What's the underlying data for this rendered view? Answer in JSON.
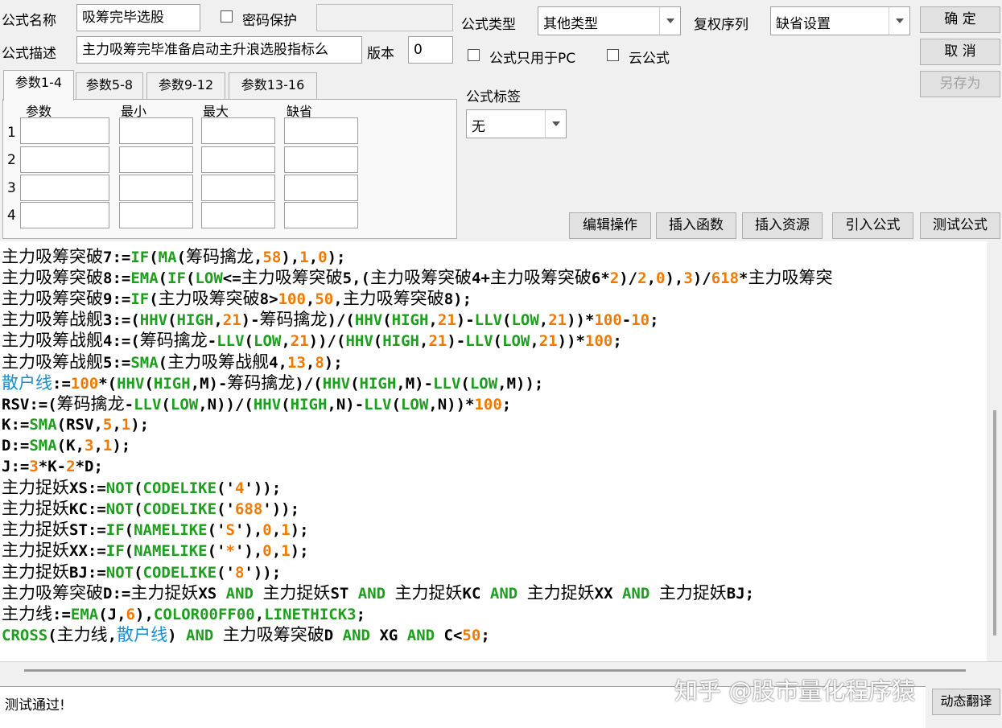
{
  "form": {
    "name_label": "公式名称",
    "name_value": "吸筹完毕选股",
    "password_label": "密码保护",
    "password_value": "",
    "desc_label": "公式描述",
    "desc_value": "主力吸筹完毕准备启动主升浪选股指标么",
    "version_label": "版本",
    "version_value": "0",
    "type_label": "公式类型",
    "type_value": "其他类型",
    "rights_label": "复权序列",
    "rights_value": "缺省设置",
    "pc_only_label": "公式只用于PC",
    "cloud_label": "云公式",
    "tag_label": "公式标签",
    "tag_value": "无"
  },
  "buttons": {
    "ok": "确 定",
    "cancel": "取 消",
    "save_as": "另存为",
    "edit_ops": "编辑操作",
    "insert_func": "插入函数",
    "insert_res": "插入资源",
    "import_formula": "引入公式",
    "test_formula": "测试公式",
    "dynamic_translate": "动态翻译"
  },
  "params": {
    "tabs": [
      "参数1-4",
      "参数5-8",
      "参数9-12",
      "参数13-16"
    ],
    "headers": [
      "参数",
      "最小",
      "最大",
      "缺省"
    ],
    "rows": [
      "1",
      "2",
      "3",
      "4"
    ]
  },
  "code_lines": [
    [
      [
        "主力吸筹突破",
        "cn"
      ],
      [
        "7:=",
        "t"
      ],
      [
        "IF",
        "f"
      ],
      [
        "(",
        "t"
      ],
      [
        "MA",
        "f"
      ],
      [
        "(",
        "t"
      ],
      [
        "筹码擒龙",
        "cn"
      ],
      [
        ",",
        "t"
      ],
      [
        "58",
        "n"
      ],
      [
        "),",
        "t"
      ],
      [
        "1",
        "n"
      ],
      [
        ",",
        "t"
      ],
      [
        "0",
        "n"
      ],
      [
        ");",
        "t"
      ]
    ],
    [
      [
        "主力吸筹突破",
        "cn"
      ],
      [
        "8:=",
        "t"
      ],
      [
        "EMA",
        "f"
      ],
      [
        "(",
        "t"
      ],
      [
        "IF",
        "f"
      ],
      [
        "(",
        "t"
      ],
      [
        "LOW",
        "f"
      ],
      [
        "<=",
        "t"
      ],
      [
        "主力吸筹突破",
        "cn"
      ],
      [
        "5,(",
        "t"
      ],
      [
        "主力吸筹突破",
        "cn"
      ],
      [
        "4+",
        "t"
      ],
      [
        "主力吸筹突破",
        "cn"
      ],
      [
        "6*",
        "t"
      ],
      [
        "2",
        "n"
      ],
      [
        ")/",
        "t"
      ],
      [
        "2",
        "n"
      ],
      [
        ",",
        "t"
      ],
      [
        "0",
        "n"
      ],
      [
        "),",
        "t"
      ],
      [
        "3",
        "n"
      ],
      [
        ")/",
        "t"
      ],
      [
        "618",
        "n"
      ],
      [
        "*",
        "t"
      ],
      [
        "主力吸筹突",
        "cn"
      ]
    ],
    [
      [
        "主力吸筹突破",
        "cn"
      ],
      [
        "9:=",
        "t"
      ],
      [
        "IF",
        "f"
      ],
      [
        "(",
        "t"
      ],
      [
        "主力吸筹突破",
        "cn"
      ],
      [
        "8>",
        "t"
      ],
      [
        "100",
        "n"
      ],
      [
        ",",
        "t"
      ],
      [
        "50",
        "n"
      ],
      [
        ",",
        "t"
      ],
      [
        "主力吸筹突破",
        "cn"
      ],
      [
        "8);",
        "t"
      ]
    ],
    [
      [
        "主力吸筹战舰",
        "cn"
      ],
      [
        "3:=(",
        "t"
      ],
      [
        "HHV",
        "f"
      ],
      [
        "(",
        "t"
      ],
      [
        "HIGH",
        "f"
      ],
      [
        ",",
        "t"
      ],
      [
        "21",
        "n"
      ],
      [
        ")-",
        "t"
      ],
      [
        "筹码擒龙",
        "cn"
      ],
      [
        ")/(",
        "t"
      ],
      [
        "HHV",
        "f"
      ],
      [
        "(",
        "t"
      ],
      [
        "HIGH",
        "f"
      ],
      [
        ",",
        "t"
      ],
      [
        "21",
        "n"
      ],
      [
        ")-",
        "t"
      ],
      [
        "LLV",
        "f"
      ],
      [
        "(",
        "t"
      ],
      [
        "LOW",
        "f"
      ],
      [
        ",",
        "t"
      ],
      [
        "21",
        "n"
      ],
      [
        "))*",
        "t"
      ],
      [
        "100",
        "n"
      ],
      [
        "-",
        "t"
      ],
      [
        "10",
        "n"
      ],
      [
        ";",
        "t"
      ]
    ],
    [
      [
        "主力吸筹战舰",
        "cn"
      ],
      [
        "4:=(",
        "t"
      ],
      [
        "筹码擒龙",
        "cn"
      ],
      [
        "-",
        "t"
      ],
      [
        "LLV",
        "f"
      ],
      [
        "(",
        "t"
      ],
      [
        "LOW",
        "f"
      ],
      [
        ",",
        "t"
      ],
      [
        "21",
        "n"
      ],
      [
        "))/(",
        "t"
      ],
      [
        "HHV",
        "f"
      ],
      [
        "(",
        "t"
      ],
      [
        "HIGH",
        "f"
      ],
      [
        ",",
        "t"
      ],
      [
        "21",
        "n"
      ],
      [
        ")-",
        "t"
      ],
      [
        "LLV",
        "f"
      ],
      [
        "(",
        "t"
      ],
      [
        "LOW",
        "f"
      ],
      [
        ",",
        "t"
      ],
      [
        "21",
        "n"
      ],
      [
        "))*",
        "t"
      ],
      [
        "100",
        "n"
      ],
      [
        ";",
        "t"
      ]
    ],
    [
      [
        "主力吸筹战舰",
        "cn"
      ],
      [
        "5:=",
        "t"
      ],
      [
        "SMA",
        "f"
      ],
      [
        "(",
        "t"
      ],
      [
        "主力吸筹战舰",
        "cn"
      ],
      [
        "4,",
        "t"
      ],
      [
        "13",
        "n"
      ],
      [
        ",",
        "t"
      ],
      [
        "8",
        "n"
      ],
      [
        ");",
        "t"
      ]
    ],
    [
      [
        "散户线",
        "b"
      ],
      [
        ":=",
        "t"
      ],
      [
        "100",
        "n"
      ],
      [
        "*(",
        "t"
      ],
      [
        "HHV",
        "f"
      ],
      [
        "(",
        "t"
      ],
      [
        "HIGH",
        "f"
      ],
      [
        ",M)-",
        "t"
      ],
      [
        "筹码擒龙",
        "cn"
      ],
      [
        ")/(",
        "t"
      ],
      [
        "HHV",
        "f"
      ],
      [
        "(",
        "t"
      ],
      [
        "HIGH",
        "f"
      ],
      [
        ",M)-",
        "t"
      ],
      [
        "LLV",
        "f"
      ],
      [
        "(",
        "t"
      ],
      [
        "LOW",
        "f"
      ],
      [
        ",M));",
        "t"
      ]
    ],
    [
      [
        "RSV:=(",
        "t"
      ],
      [
        "筹码擒龙",
        "cn"
      ],
      [
        "-",
        "t"
      ],
      [
        "LLV",
        "f"
      ],
      [
        "(",
        "t"
      ],
      [
        "LOW",
        "f"
      ],
      [
        ",N))/(",
        "t"
      ],
      [
        "HHV",
        "f"
      ],
      [
        "(",
        "t"
      ],
      [
        "HIGH",
        "f"
      ],
      [
        ",N)-",
        "t"
      ],
      [
        "LLV",
        "f"
      ],
      [
        "(",
        "t"
      ],
      [
        "LOW",
        "f"
      ],
      [
        ",N))*",
        "t"
      ],
      [
        "100",
        "n"
      ],
      [
        ";",
        "t"
      ]
    ],
    [
      [
        "K:=",
        "t"
      ],
      [
        "SMA",
        "f"
      ],
      [
        "(RSV,",
        "t"
      ],
      [
        "5",
        "n"
      ],
      [
        ",",
        "t"
      ],
      [
        "1",
        "n"
      ],
      [
        ");",
        "t"
      ]
    ],
    [
      [
        "D:=",
        "t"
      ],
      [
        "SMA",
        "f"
      ],
      [
        "(K,",
        "t"
      ],
      [
        "3",
        "n"
      ],
      [
        ",",
        "t"
      ],
      [
        "1",
        "n"
      ],
      [
        ");",
        "t"
      ]
    ],
    [
      [
        "J:=",
        "t"
      ],
      [
        "3",
        "n"
      ],
      [
        "*K-",
        "t"
      ],
      [
        "2",
        "n"
      ],
      [
        "*D;",
        "t"
      ]
    ],
    [
      [
        "主力捉妖",
        "cn"
      ],
      [
        "XS:=",
        "t"
      ],
      [
        "NOT",
        "f"
      ],
      [
        "(",
        "t"
      ],
      [
        "CODELIKE",
        "f"
      ],
      [
        "('",
        "t"
      ],
      [
        "4",
        "n"
      ],
      [
        "'));",
        "t"
      ]
    ],
    [
      [
        "主力捉妖",
        "cn"
      ],
      [
        "KC:=",
        "t"
      ],
      [
        "NOT",
        "f"
      ],
      [
        "(",
        "t"
      ],
      [
        "CODELIKE",
        "f"
      ],
      [
        "('",
        "t"
      ],
      [
        "688",
        "n"
      ],
      [
        "'));",
        "t"
      ]
    ],
    [
      [
        "主力捉妖",
        "cn"
      ],
      [
        "ST:=",
        "t"
      ],
      [
        "IF",
        "f"
      ],
      [
        "(",
        "t"
      ],
      [
        "NAMELIKE",
        "f"
      ],
      [
        "('",
        "t"
      ],
      [
        "S",
        "n"
      ],
      [
        "'),",
        "t"
      ],
      [
        "0",
        "n"
      ],
      [
        ",",
        "t"
      ],
      [
        "1",
        "n"
      ],
      [
        ");",
        "t"
      ]
    ],
    [
      [
        "主力捉妖",
        "cn"
      ],
      [
        "XX:=",
        "t"
      ],
      [
        "IF",
        "f"
      ],
      [
        "(",
        "t"
      ],
      [
        "NAMELIKE",
        "f"
      ],
      [
        "('",
        "t"
      ],
      [
        "*",
        "n"
      ],
      [
        "'),",
        "t"
      ],
      [
        "0",
        "n"
      ],
      [
        ",",
        "t"
      ],
      [
        "1",
        "n"
      ],
      [
        ");",
        "t"
      ]
    ],
    [
      [
        "主力捉妖",
        "cn"
      ],
      [
        "BJ:=",
        "t"
      ],
      [
        "NOT",
        "f"
      ],
      [
        "(",
        "t"
      ],
      [
        "CODELIKE",
        "f"
      ],
      [
        "('",
        "t"
      ],
      [
        "8",
        "n"
      ],
      [
        "'));",
        "t"
      ]
    ],
    [
      [
        "主力吸筹突破",
        "cn"
      ],
      [
        "D:=",
        "t"
      ],
      [
        "主力捉妖",
        "cn"
      ],
      [
        "XS ",
        "t"
      ],
      [
        "AND",
        "f"
      ],
      [
        " ",
        "t"
      ],
      [
        "主力捉妖",
        "cn"
      ],
      [
        "ST ",
        "t"
      ],
      [
        "AND",
        "f"
      ],
      [
        " ",
        "t"
      ],
      [
        "主力捉妖",
        "cn"
      ],
      [
        "KC ",
        "t"
      ],
      [
        "AND",
        "f"
      ],
      [
        " ",
        "t"
      ],
      [
        "主力捉妖",
        "cn"
      ],
      [
        "XX ",
        "t"
      ],
      [
        "AND",
        "f"
      ],
      [
        " ",
        "t"
      ],
      [
        "主力捉妖",
        "cn"
      ],
      [
        "BJ;",
        "t"
      ]
    ],
    [
      [
        "主力线",
        "cn"
      ],
      [
        ":=",
        "t"
      ],
      [
        "EMA",
        "f"
      ],
      [
        "(J,",
        "t"
      ],
      [
        "6",
        "n"
      ],
      [
        "),",
        "t"
      ],
      [
        "COLOR00FF00",
        "f"
      ],
      [
        ",",
        "t"
      ],
      [
        "LINETHICK3",
        "f"
      ],
      [
        ";",
        "t"
      ]
    ],
    [
      [
        "CROSS",
        "f"
      ],
      [
        "(",
        "t"
      ],
      [
        "主力线",
        "cn"
      ],
      [
        ",",
        "t"
      ],
      [
        "散户线",
        "b"
      ],
      [
        ") ",
        "t"
      ],
      [
        "AND",
        "f"
      ],
      [
        " ",
        "t"
      ],
      [
        "主力吸筹突破",
        "cn"
      ],
      [
        "D ",
        "t"
      ],
      [
        "AND",
        "f"
      ],
      [
        " XG ",
        "t"
      ],
      [
        "AND",
        "f"
      ],
      [
        " C<",
        "t"
      ],
      [
        "50",
        "n"
      ],
      [
        ";",
        "t"
      ]
    ]
  ],
  "status": {
    "message": "测试通过!"
  },
  "watermark": "知乎 @股市量化程序猿",
  "colors": {
    "function": "#1e9e1e",
    "number": "#f07a00",
    "variable_blue": "#1a8fd0"
  }
}
